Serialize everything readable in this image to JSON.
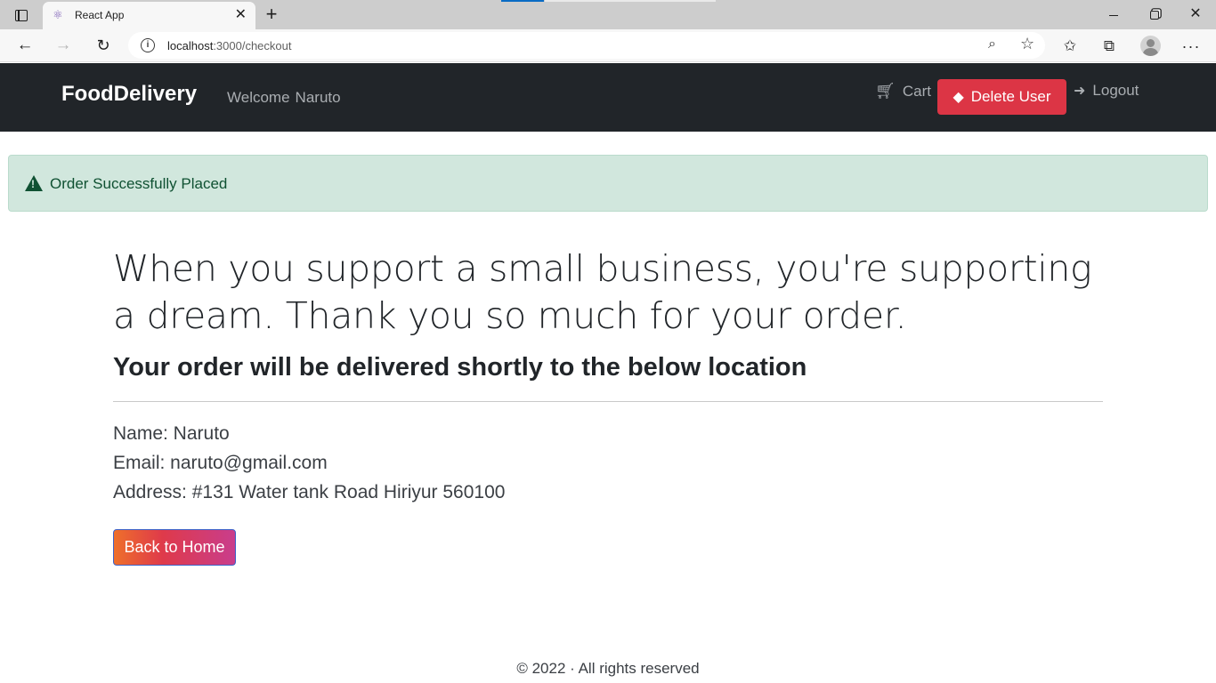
{
  "browser": {
    "tab_title": "React App",
    "url_host": "localhost",
    "url_rest": ":3000/checkout",
    "icons": {
      "tab_actions": "tab-actions-icon",
      "favicon": "react-atom-icon",
      "close": "close-icon",
      "new_tab": "plus-icon",
      "back": "arrow-left-icon",
      "forward": "arrow-right-icon",
      "reload": "reload-icon",
      "site_info": "info-icon",
      "zoom": "zoom-icon",
      "add_favorite": "star-add-icon",
      "favorites": "favorites-icon",
      "collections": "collections-icon",
      "profile": "profile-avatar",
      "more": "more-dots-icon"
    }
  },
  "navbar": {
    "brand": "FoodDelivery",
    "welcome_label": "Welcome",
    "user_name": "Naruto",
    "cart_label": "Cart",
    "delete_label": "Delete User",
    "logout_label": "Logout",
    "colors": {
      "background": "#212529",
      "delete": "#dc3545"
    }
  },
  "alert": {
    "message": "Order Successfully Placed",
    "colors": {
      "background": "#d1e7dd",
      "text": "#0f5132"
    }
  },
  "main": {
    "lead": "When you support a small business, you're supporting a dream. Thank you so much for your order.",
    "subheading": "Your order will be delivered shortly to the below location",
    "name_line": "Name: Naruto",
    "email_line": "Email: naruto@gmail.com",
    "address_line": "Address: #131 Water tank Road Hiriyur 560100",
    "home_button": "Back to Home"
  },
  "footer": {
    "text": "© 2022 · All rights reserved"
  }
}
